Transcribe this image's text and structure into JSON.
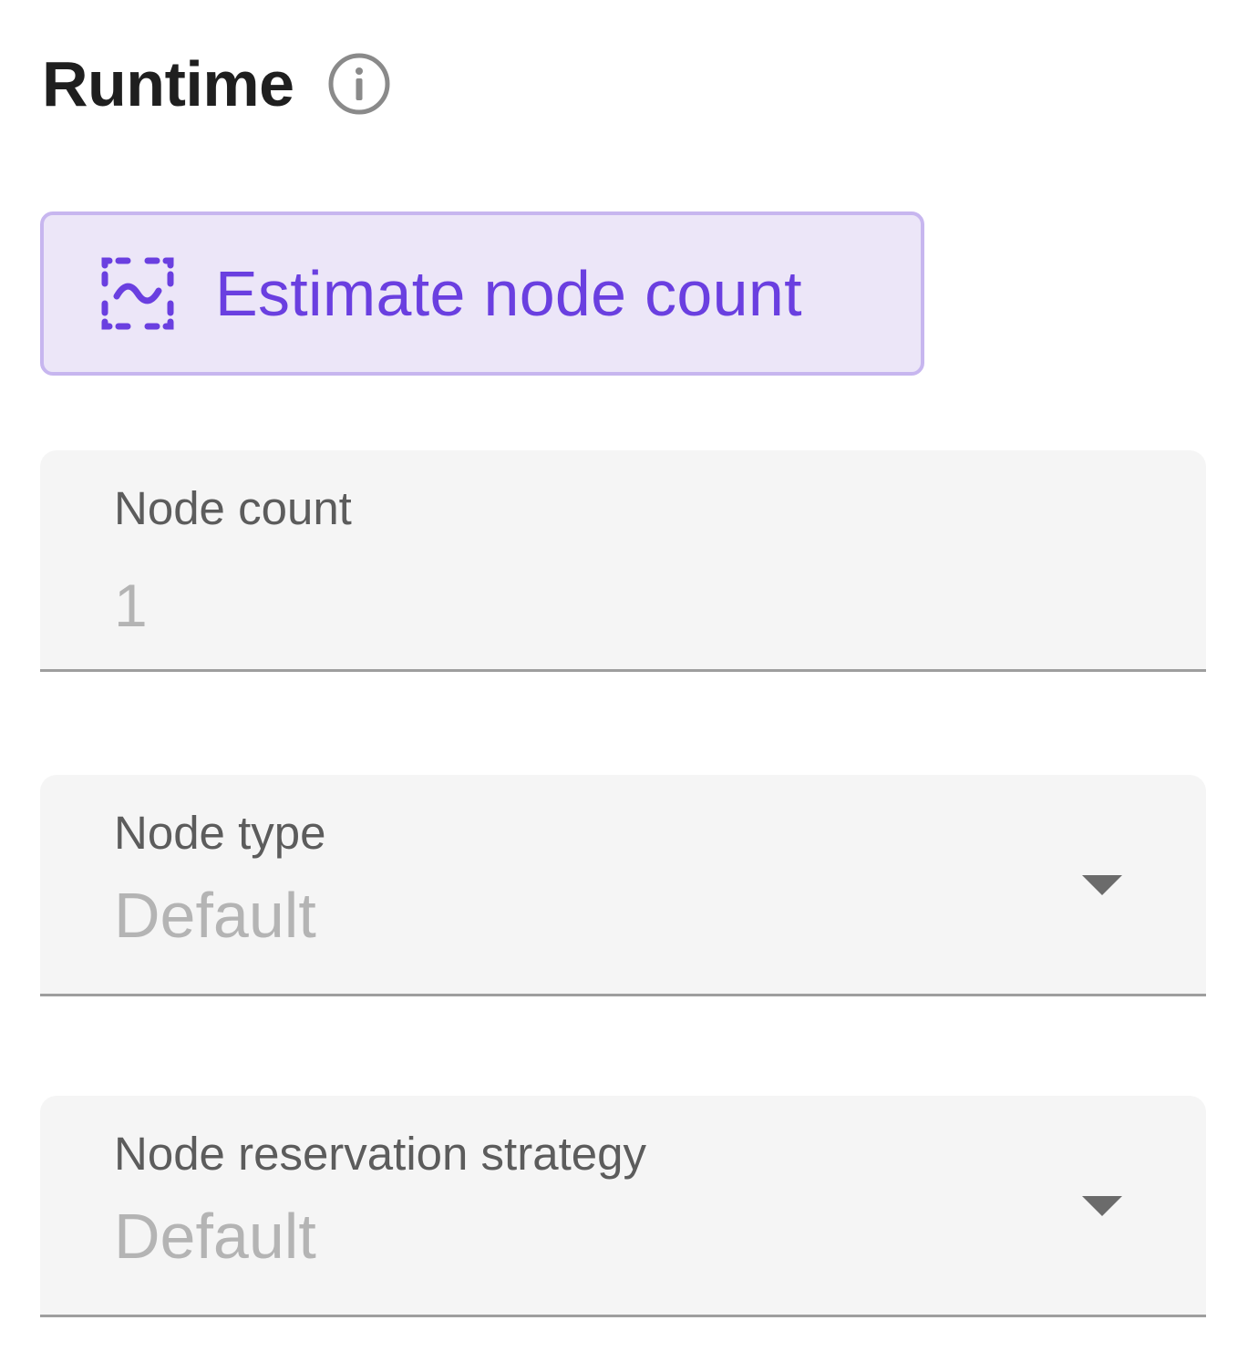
{
  "section": {
    "title": "Runtime",
    "info_icon": "info-circle-icon"
  },
  "estimate_button": {
    "label": "Estimate node count",
    "icon": "wave-scan-icon",
    "accent_color": "#6a3fe0",
    "background_color": "#ece6f8",
    "border_color": "#c7b6ef"
  },
  "fields": {
    "node_count": {
      "label": "Node count",
      "value": "1"
    },
    "node_type": {
      "label": "Node type",
      "value": "Default",
      "icon": "chevron-down-icon"
    },
    "node_reservation_strategy": {
      "label": "Node reservation strategy",
      "value": "Default",
      "icon": "chevron-down-icon"
    }
  }
}
